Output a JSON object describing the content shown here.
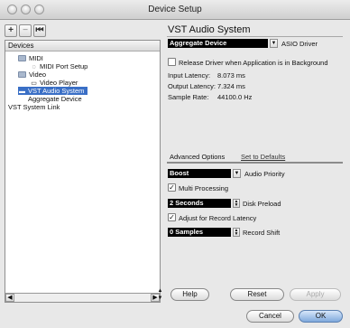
{
  "window": {
    "title": "Device Setup"
  },
  "toolbar": {
    "add": "+",
    "remove": "−",
    "reset": "⏮"
  },
  "devices": {
    "header": "Devices",
    "items": [
      {
        "label": "MIDI",
        "icon": "folder-icon"
      },
      {
        "label": "MIDI Port Setup",
        "icon": "midi-port-icon"
      },
      {
        "label": "Video",
        "icon": "folder-icon"
      },
      {
        "label": "Video Player",
        "icon": "video-player-icon"
      },
      {
        "label": "VST Audio System",
        "icon": "vst-audio-icon"
      },
      {
        "label": "Aggregate Device",
        "icon": ""
      },
      {
        "label": "VST System Link",
        "icon": ""
      }
    ]
  },
  "vst": {
    "heading": "VST Audio System",
    "driver_value": "Aggregate Device",
    "driver_label": "ASIO Driver",
    "release_driver_label": "Release Driver when Application is in Background",
    "release_driver_checked": false,
    "input_latency_label": "Input Latency:",
    "input_latency": "8.073 ms",
    "output_latency_label": "Output Latency:",
    "output_latency": "7.324 ms",
    "sample_rate_label": "Sample Rate:",
    "sample_rate": "44100.0 Hz"
  },
  "advanced": {
    "tab_label": "Advanced Options",
    "defaults_label": "Set to Defaults",
    "audio_priority_value": "Boost",
    "audio_priority_label": "Audio Priority",
    "multi_processing_label": "Multi Processing",
    "multi_processing_checked": true,
    "disk_preload_value": "2 Seconds",
    "disk_preload_label": "Disk Preload",
    "adjust_latency_label": "Adjust for Record Latency",
    "adjust_latency_checked": true,
    "record_shift_value": "0 Samples",
    "record_shift_label": "Record Shift"
  },
  "buttons": {
    "help": "Help",
    "reset": "Reset",
    "apply": "Apply",
    "cancel": "Cancel",
    "ok": "OK"
  },
  "colors": {
    "selection": "#3a6fc6",
    "default_button": "#7fa9dc"
  }
}
